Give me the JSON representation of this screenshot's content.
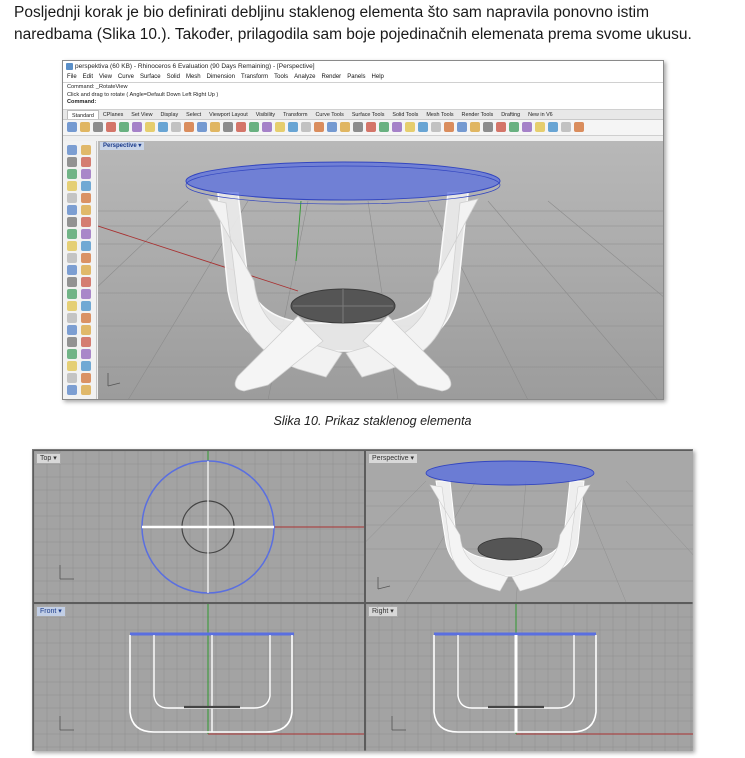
{
  "paragraph": "Posljednji korak je bio definirati debljinu staklenog elementa što sam napravila ponovno istim naredbama (Slika 10.). Također, prilagodila sam boje pojedinačnih elemenata prema svome ukusu.",
  "rhino_window": {
    "title": "perspektiva (60 KB) - Rhinoceros 6 Evaluation (90 Days Remaining) - [Perspective]",
    "menu": [
      "File",
      "Edit",
      "View",
      "Curve",
      "Surface",
      "Solid",
      "Mesh",
      "Dimension",
      "Transform",
      "Tools",
      "Analyze",
      "Render",
      "Panels",
      "Help"
    ],
    "command_history": [
      "Command: _RotateView",
      "Click and drag to rotate ( Angle=Default  Down  Left  Right  Up )"
    ],
    "command_prompt": "Command:",
    "toolbar_tabs": [
      "Standard",
      "CPlanes",
      "Set View",
      "Display",
      "Select",
      "Viewport Layout",
      "Visibility",
      "Transform",
      "Curve Tools",
      "Surface Tools",
      "Solid Tools",
      "Mesh Tools",
      "Render Tools",
      "Drafting",
      "New in V6"
    ],
    "active_tab": "Standard",
    "viewport_label": "Perspective"
  },
  "caption": "Slika 10. Prikaz staklenog elementa",
  "quad_viewports": {
    "top": "Top",
    "perspective": "Perspective",
    "front": "Front",
    "right": "Right"
  },
  "colors": {
    "glass_top": "#5a6fe0",
    "viewport_bg": "#a3a3a3",
    "grid": "#8f8f8f",
    "x_axis": "#a83232",
    "y_axis": "#2f9a2f"
  }
}
